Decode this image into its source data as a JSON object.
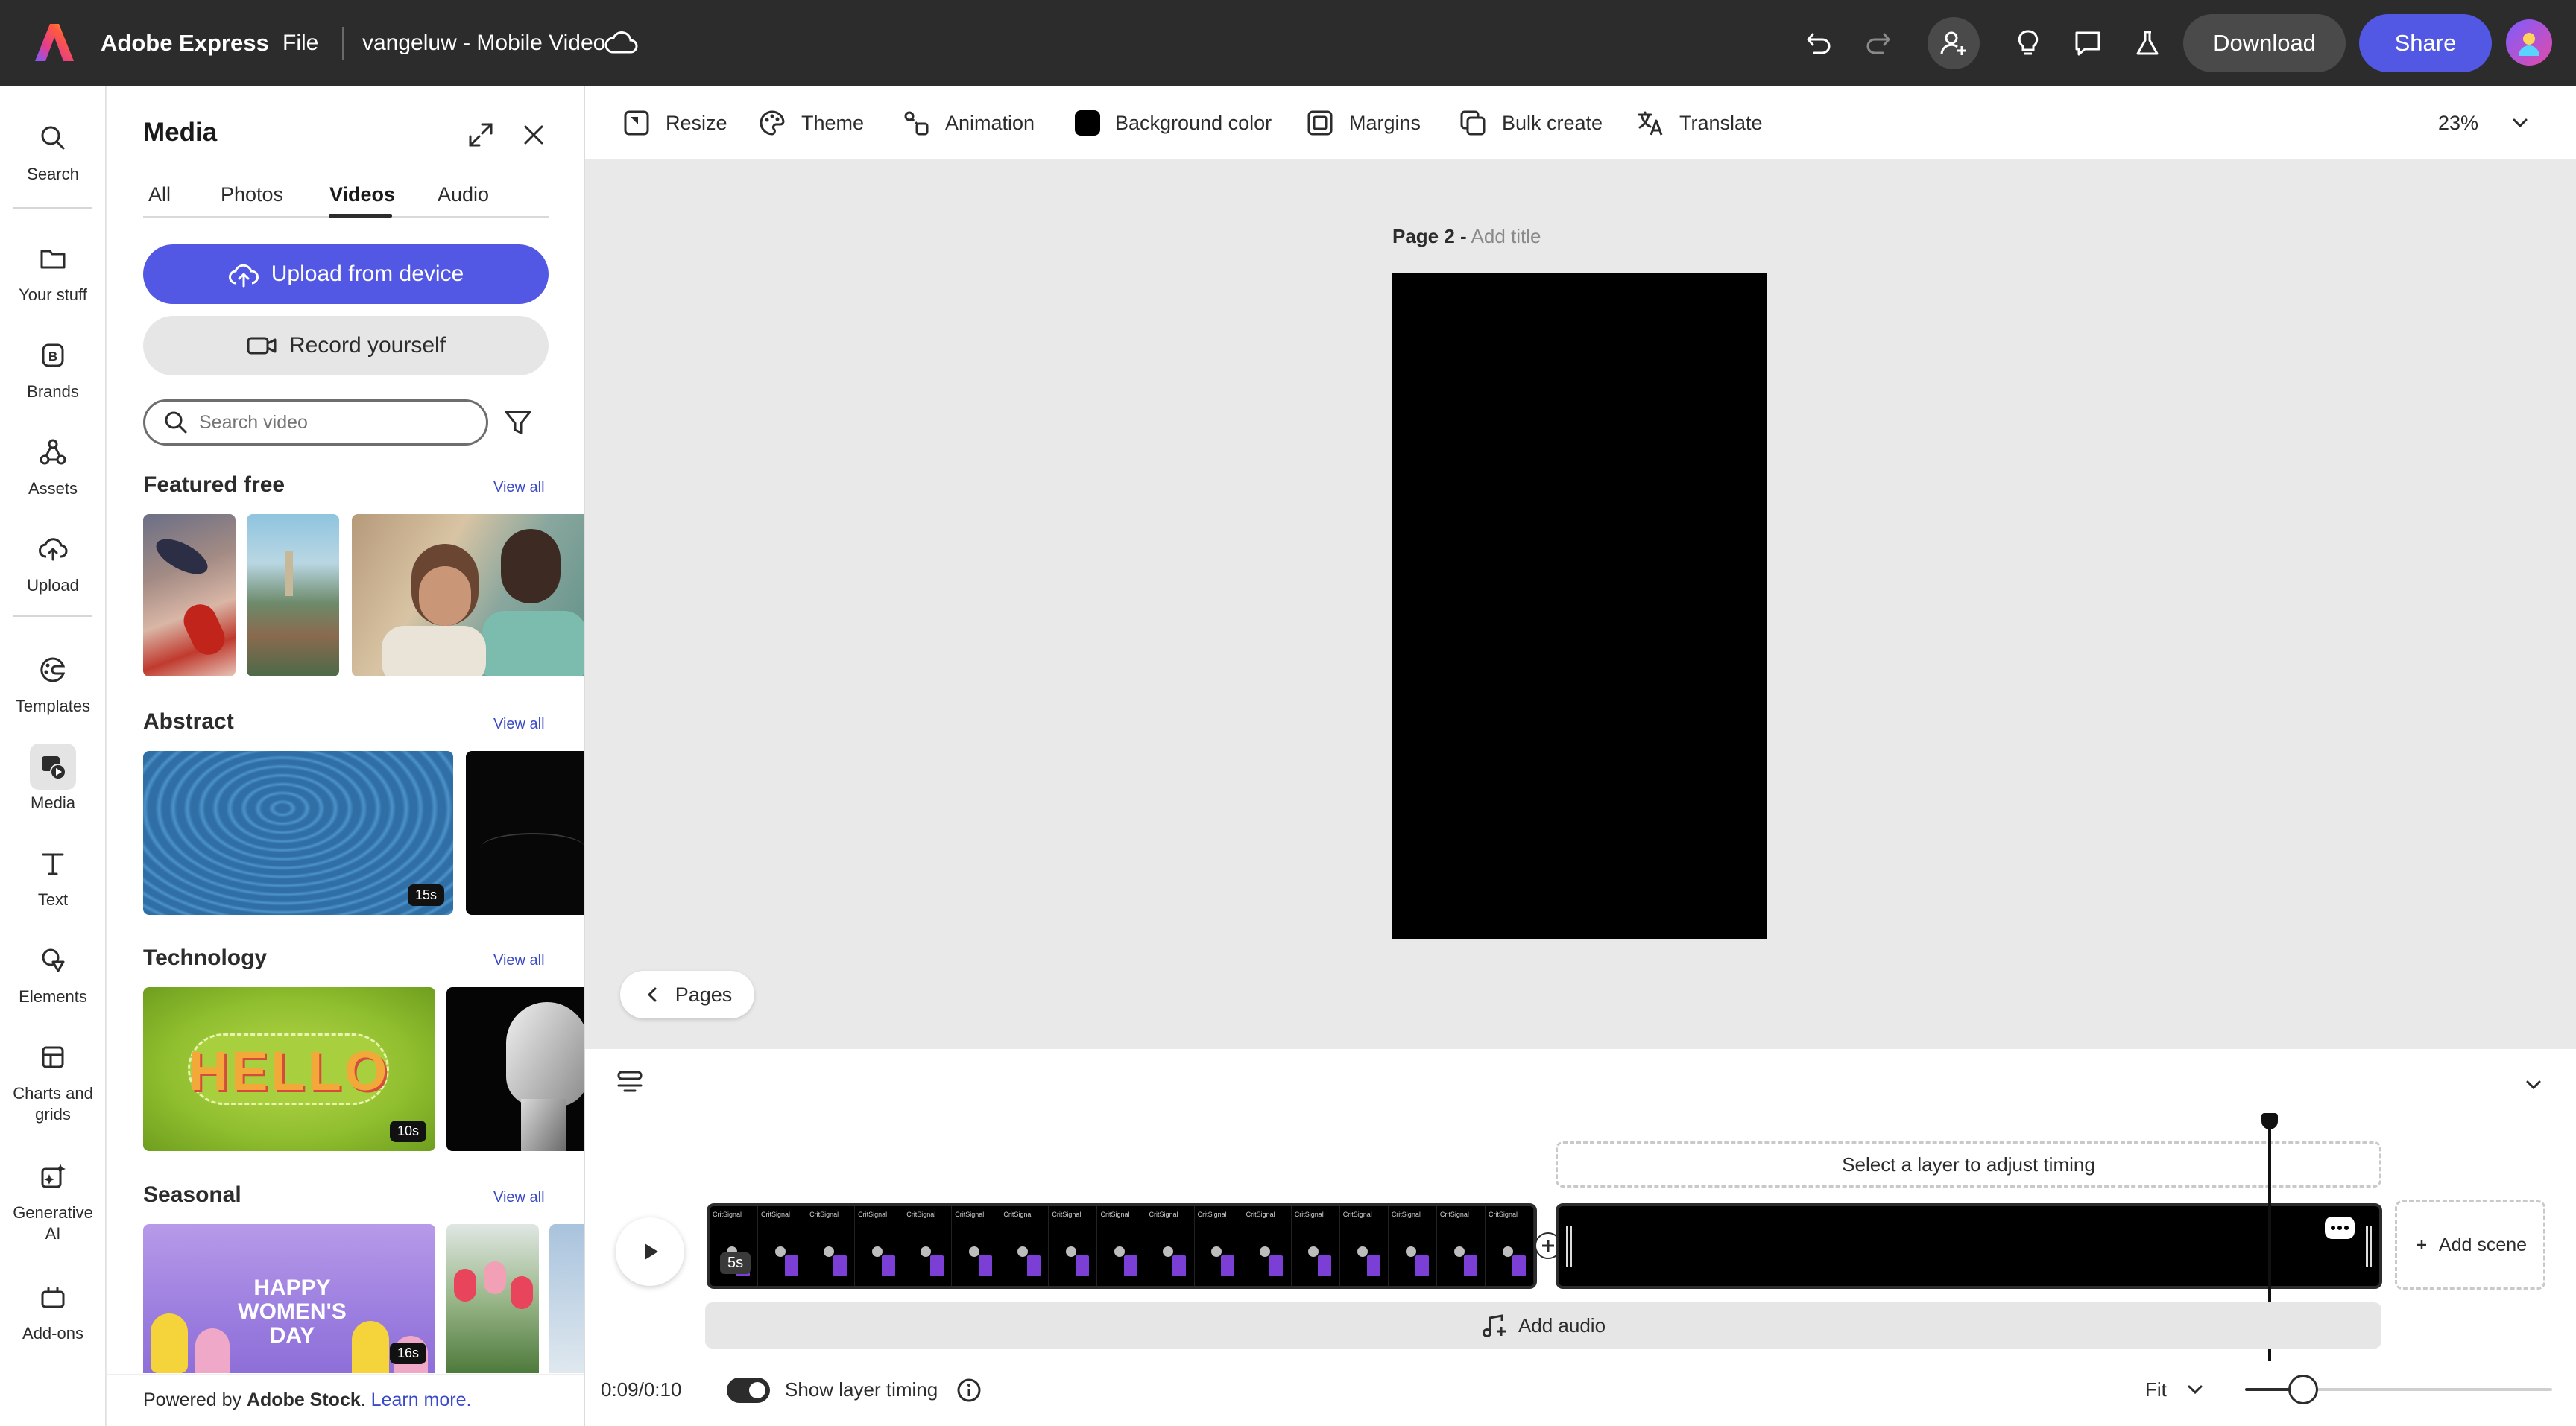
{
  "app": {
    "name": "Adobe Express",
    "file_menu": "File",
    "document_title": "vangeluw - Mobile Video",
    "download_label": "Download",
    "share_label": "Share",
    "brand_color": "#5258e4"
  },
  "rail": {
    "items": [
      {
        "label": "Search",
        "icon": "search-icon"
      },
      {
        "label": "Your stuff",
        "icon": "folder-icon"
      },
      {
        "label": "Brands",
        "icon": "brand-icon"
      },
      {
        "label": "Assets",
        "icon": "assets-icon"
      },
      {
        "label": "Upload",
        "icon": "upload-icon"
      },
      {
        "label": "Templates",
        "icon": "templates-icon"
      },
      {
        "label": "Media",
        "icon": "media-icon",
        "active": true
      },
      {
        "label": "Text",
        "icon": "text-icon"
      },
      {
        "label": "Elements",
        "icon": "elements-icon"
      },
      {
        "label": "Charts and grids",
        "icon": "charts-icon"
      },
      {
        "label": "Generative AI",
        "icon": "sparkle-icon"
      },
      {
        "label": "Add-ons",
        "icon": "addons-icon"
      }
    ]
  },
  "panel": {
    "title": "Media",
    "tabs": [
      "All",
      "Photos",
      "Videos",
      "Audio"
    ],
    "active_tab": "Videos",
    "upload_label": "Upload from device",
    "record_label": "Record yourself",
    "search_placeholder": "Search video",
    "view_all": "View all",
    "sections": [
      {
        "title": "Featured free"
      },
      {
        "title": "Abstract",
        "durations": [
          "15s"
        ]
      },
      {
        "title": "Technology",
        "durations": [
          "10s"
        ]
      },
      {
        "title": "Seasonal",
        "durations": [
          "16s"
        ],
        "banner_text": "HAPPY WOMEN'S DAY"
      }
    ],
    "technology_thumb_text": "HELLO",
    "footer": {
      "prefix": "Powered by ",
      "brand": "Adobe Stock",
      "suffix": ".",
      "link": "Learn more."
    }
  },
  "toolbar": {
    "items": [
      "Resize",
      "Theme",
      "Animation",
      "Background color",
      "Margins",
      "Bulk create",
      "Translate"
    ],
    "zoom": "23%"
  },
  "canvas": {
    "page_label": "Page 2 -",
    "add_title": "Add title",
    "pages_button": "Pages"
  },
  "timeline": {
    "hint": "Select a layer to adjust timing",
    "scene1_duration": "5s",
    "scene1_frame_text": "CritSignal",
    "add_scene_label": "Add scene",
    "add_audio_label": "Add audio",
    "time_display": "0:09/0:10",
    "show_layer_timing_label": "Show layer timing",
    "fit_label": "Fit",
    "zoom_slider_level": 0.19
  }
}
